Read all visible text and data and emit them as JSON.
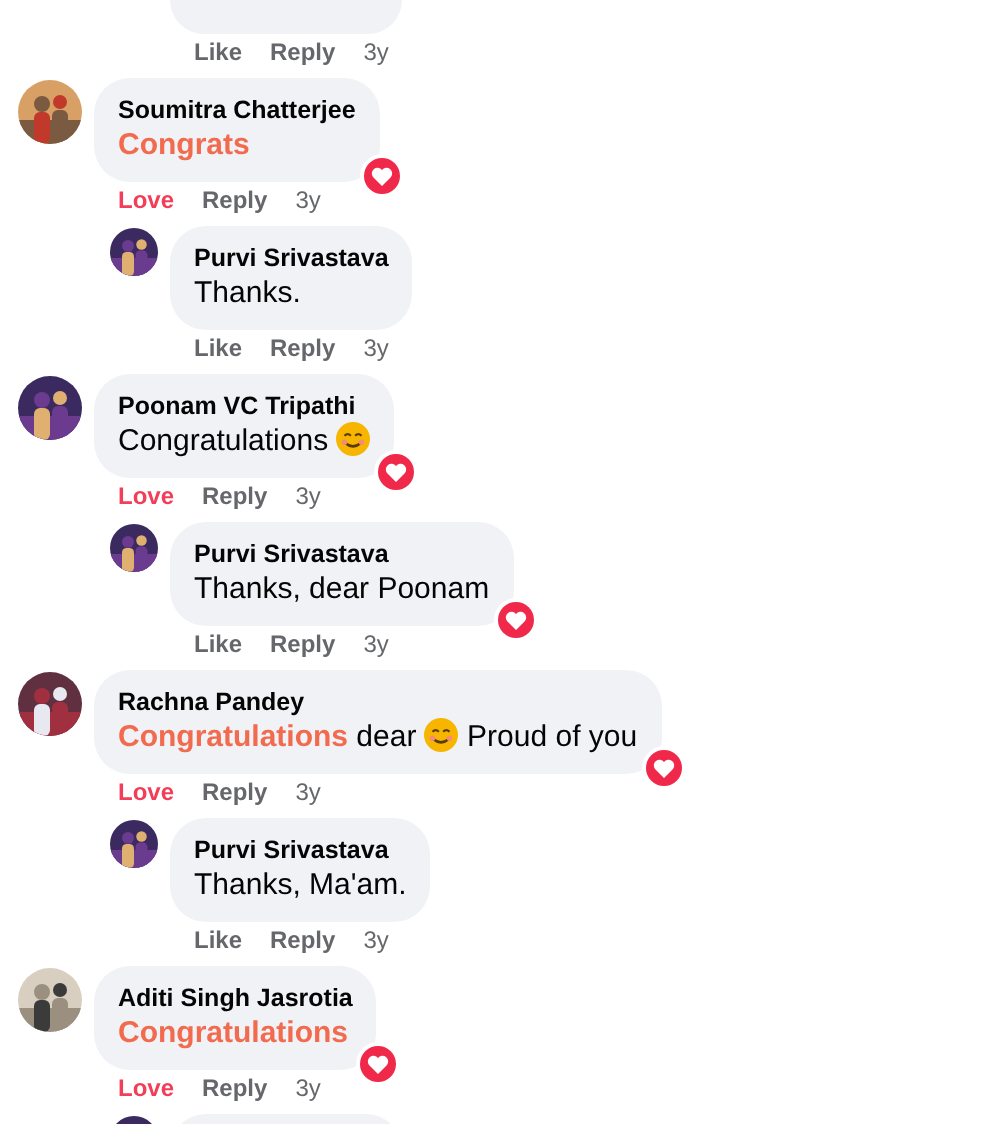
{
  "above": {
    "reaction": "Like",
    "loved": false,
    "reply": "Reply",
    "time": "3y"
  },
  "comments": [
    {
      "author": "Soumitra Chatterjee",
      "message": [
        {
          "kind": "highlight",
          "text": "Congrats"
        }
      ],
      "heart": true,
      "actions": {
        "reaction": "Love",
        "loved": true,
        "reply": "Reply",
        "time": "3y"
      },
      "replies": [
        {
          "kind": "reply",
          "author": "Purvi Srivastava",
          "message": [
            {
              "kind": "text",
              "text": "Thanks."
            }
          ],
          "heart": false,
          "actions": {
            "reaction": "Like",
            "loved": false,
            "reply": "Reply",
            "time": "3y"
          }
        }
      ]
    },
    {
      "author": "Poonam VC Tripathi",
      "message": [
        {
          "kind": "text",
          "text": "Congratulations "
        },
        {
          "kind": "emoji"
        }
      ],
      "heart": true,
      "actions": {
        "reaction": "Love",
        "loved": true,
        "reply": "Reply",
        "time": "3y"
      },
      "replies": [
        {
          "kind": "reply",
          "author": "Purvi Srivastava",
          "message": [
            {
              "kind": "text",
              "text": "Thanks, dear Poonam"
            }
          ],
          "heart": true,
          "actions": {
            "reaction": "Like",
            "loved": false,
            "reply": "Reply",
            "time": "3y"
          }
        }
      ]
    },
    {
      "author": "Rachna Pandey",
      "message": [
        {
          "kind": "highlight",
          "text": "Congratulations"
        },
        {
          "kind": "text",
          "text": " dear "
        },
        {
          "kind": "emoji"
        },
        {
          "kind": "text",
          "text": " Proud of you"
        }
      ],
      "heart": true,
      "actions": {
        "reaction": "Love",
        "loved": true,
        "reply": "Reply",
        "time": "3y"
      },
      "replies": [
        {
          "kind": "reply",
          "author": "Purvi Srivastava",
          "message": [
            {
              "kind": "text",
              "text": "Thanks, Ma'am."
            }
          ],
          "heart": false,
          "actions": {
            "reaction": "Like",
            "loved": false,
            "reply": "Reply",
            "time": "3y"
          }
        }
      ]
    },
    {
      "author": "Aditi Singh Jasrotia",
      "message": [
        {
          "kind": "highlight",
          "text": "Congratulations"
        }
      ],
      "heart": true,
      "actions": {
        "reaction": "Love",
        "loved": true,
        "reply": "Reply",
        "time": "3y"
      },
      "replies": [
        {
          "kind": "cut"
        }
      ]
    }
  ]
}
